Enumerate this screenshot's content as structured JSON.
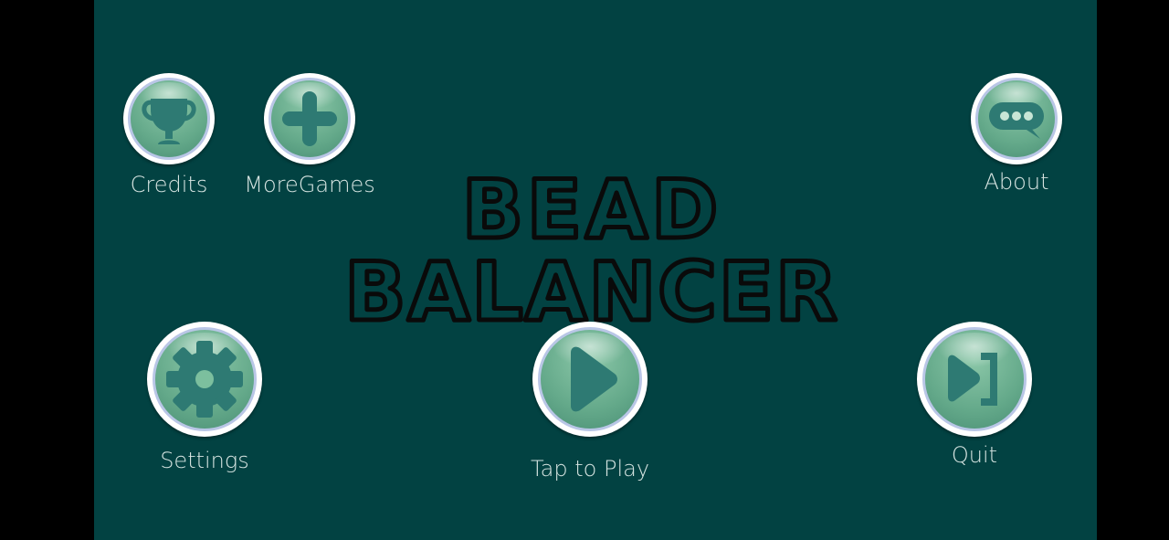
{
  "title": {
    "line1": "BEAD",
    "line2": "BALANCER"
  },
  "buttons": {
    "credits": {
      "label": "Credits",
      "icon": "trophy-icon"
    },
    "more_games": {
      "label": "MoreGames",
      "icon": "plus-icon"
    },
    "about": {
      "label": "About",
      "icon": "speech-bubble-icon"
    },
    "settings": {
      "label": "Settings",
      "icon": "gear-icon"
    },
    "play": {
      "label": "Tap to Play",
      "icon": "play-icon"
    },
    "quit": {
      "label": "Quit",
      "icon": "exit-icon"
    }
  },
  "colors": {
    "background": "#024242",
    "letterbox": "#000000",
    "orb_green": "#64a98a",
    "icon_teal": "#2e7a73",
    "label_text": "#d6e4e1"
  }
}
